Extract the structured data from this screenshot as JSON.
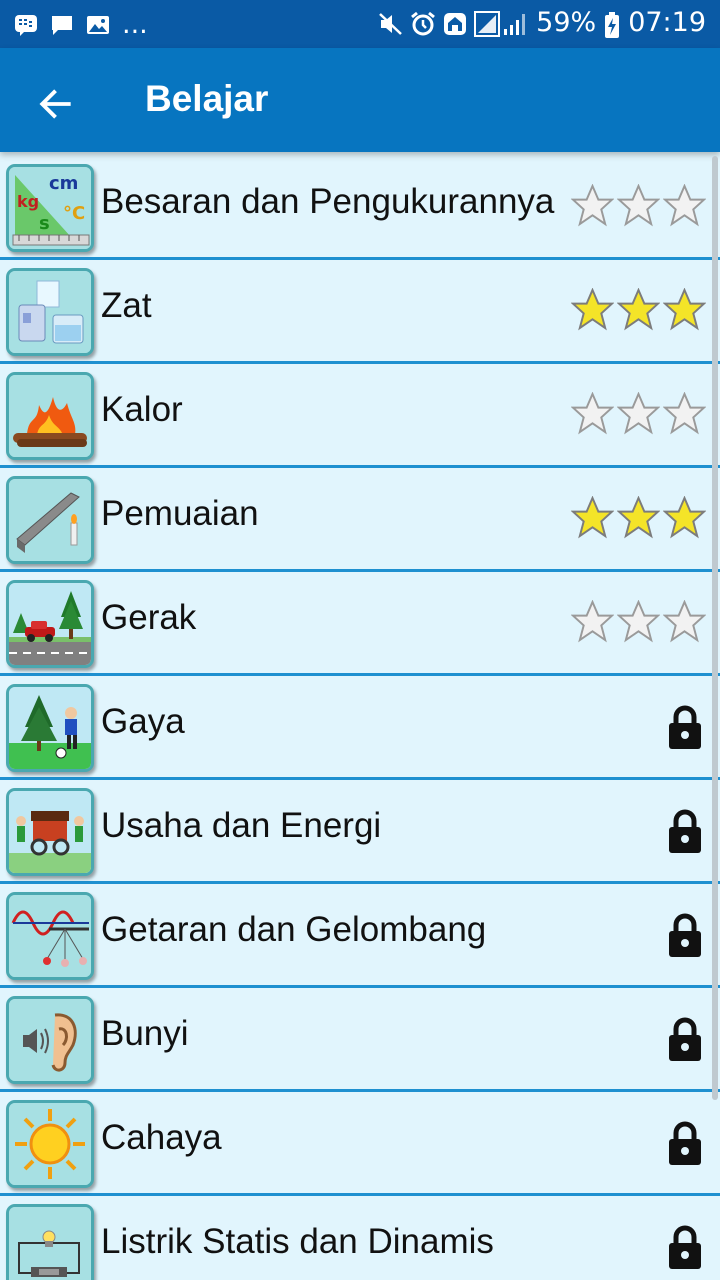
{
  "status_bar": {
    "dots": "...",
    "battery": "59%",
    "time": "07:19"
  },
  "app_bar": {
    "title": "Belajar",
    "back_icon": "arrow-left-icon"
  },
  "colors": {
    "status_bar": "#0a5aa5",
    "app_bar": "#0775c0",
    "list_bg": "#e1f5fd",
    "divider": "#1e90d0",
    "star_filled": "#f4e428",
    "star_empty": "#f2f2f2"
  },
  "lessons": [
    {
      "label": "Besaran dan Pengukurannya",
      "status": "stars",
      "stars_earned": 0,
      "icon": "measurement-icon"
    },
    {
      "label": "Zat",
      "status": "stars",
      "stars_earned": 3,
      "icon": "matter-icon"
    },
    {
      "label": "Kalor",
      "status": "stars",
      "stars_earned": 0,
      "icon": "fire-icon"
    },
    {
      "label": "Pemuaian",
      "status": "stars",
      "stars_earned": 3,
      "icon": "expansion-icon"
    },
    {
      "label": "Gerak",
      "status": "stars",
      "stars_earned": 0,
      "icon": "car-motion-icon"
    },
    {
      "label": "Gaya",
      "status": "locked",
      "icon": "force-icon"
    },
    {
      "label": "Usaha dan Energi",
      "status": "locked",
      "icon": "work-energy-icon"
    },
    {
      "label": "Getaran dan Gelombang",
      "status": "locked",
      "icon": "wave-icon"
    },
    {
      "label": "Bunyi",
      "status": "locked",
      "icon": "ear-sound-icon"
    },
    {
      "label": "Cahaya",
      "status": "locked",
      "icon": "sun-icon"
    },
    {
      "label": "Listrik Statis dan Dinamis",
      "status": "locked",
      "icon": "circuit-icon"
    }
  ]
}
